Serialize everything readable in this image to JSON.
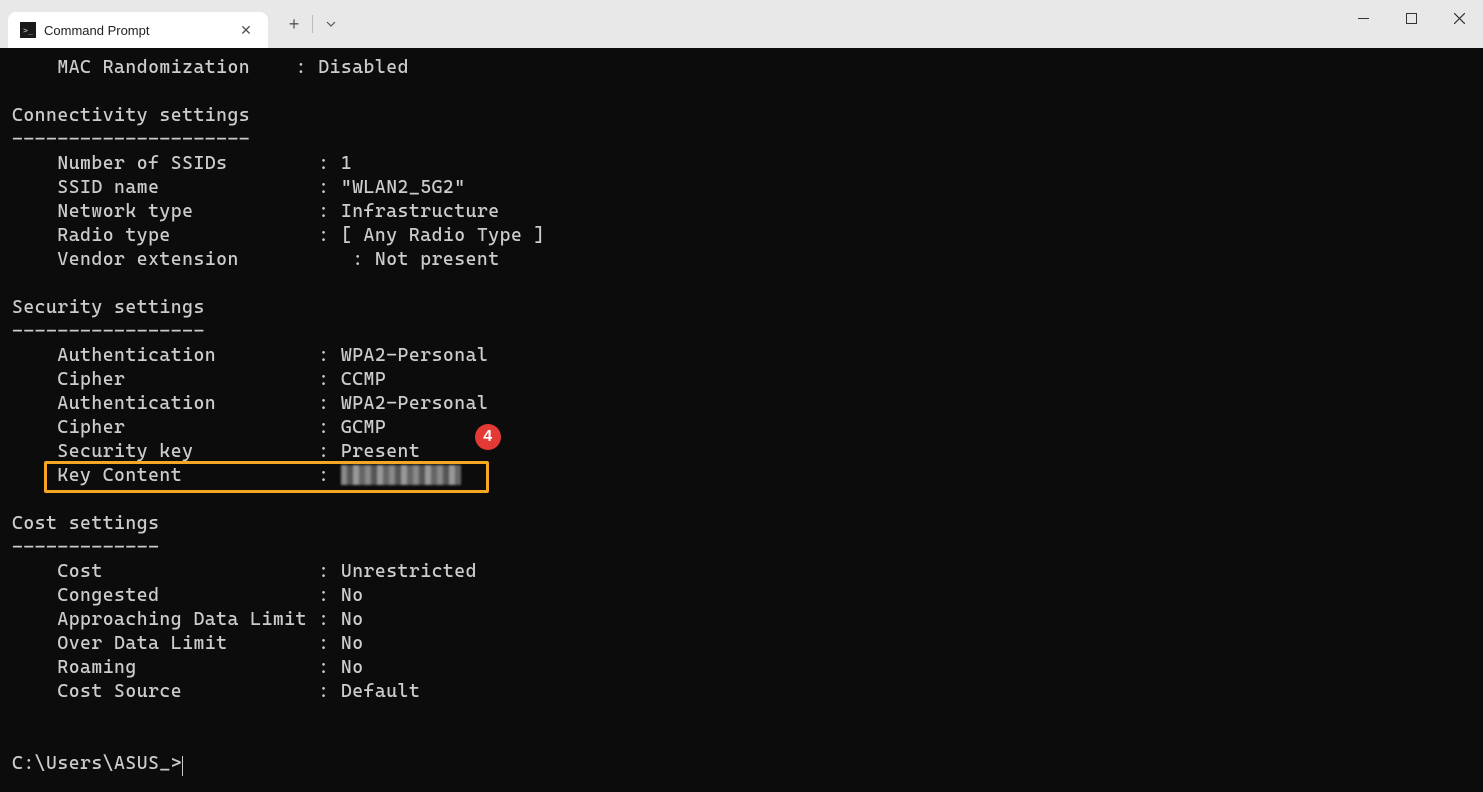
{
  "window": {
    "tab_title": "Command Prompt"
  },
  "terminal": {
    "mac_randomization_label": "    MAC Randomization    : ",
    "mac_randomization_value": "Disabled",
    "connectivity_header": "Connectivity settings",
    "connectivity_divider": "---------------------",
    "num_ssids_label": "    Number of SSIDs        : ",
    "num_ssids_value": "1",
    "ssid_name_label": "    SSID name              : ",
    "ssid_name_value": "\"WLAN2_5G2\"",
    "network_type_label": "    Network type           : ",
    "network_type_value": "Infrastructure",
    "radio_type_label": "    Radio type             : ",
    "radio_type_value": "[ Any Radio Type ]",
    "vendor_ext_label": "    Vendor extension          : ",
    "vendor_ext_value": "Not present",
    "security_header": "Security settings",
    "security_divider": "-----------------",
    "auth1_label": "    Authentication         : ",
    "auth1_value": "WPA2-Personal",
    "cipher1_label": "    Cipher                 : ",
    "cipher1_value": "CCMP",
    "auth2_label": "    Authentication         : ",
    "auth2_value": "WPA2-Personal",
    "cipher2_label": "    Cipher                 : ",
    "cipher2_value": "GCMP",
    "seckey_label": "    Security key           : ",
    "seckey_value": "Present",
    "keycontent_label": "    Key Content            : ",
    "cost_header": "Cost settings",
    "cost_divider": "-------------",
    "cost_label": "    Cost                   : ",
    "cost_value": "Unrestricted",
    "congested_label": "    Congested              : ",
    "congested_value": "No",
    "approach_label": "    Approaching Data Limit : ",
    "approach_value": "No",
    "overlimit_label": "    Over Data Limit        : ",
    "overlimit_value": "No",
    "roaming_label": "    Roaming                : ",
    "roaming_value": "No",
    "costsrc_label": "    Cost Source            : ",
    "costsrc_value": "Default",
    "prompt": "C:\\Users\\ASUS_>"
  },
  "annotation": {
    "badge_number": "4"
  }
}
